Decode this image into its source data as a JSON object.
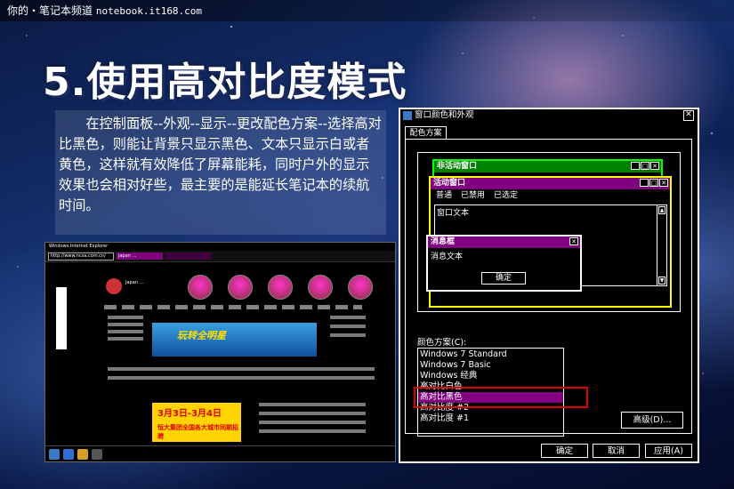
{
  "header": {
    "site_name": "你的・笔记本频道",
    "site_url": "notebook.it168.com"
  },
  "title": "5.使用高对比度模式",
  "description": "在控制面板--外观--显示--更改配色方案--选择高对比黑色，则能让背景只显示黑色、文本只显示白或者黄色，这样就有效降低了屏幕能耗，同时户外的显示效果也会相对好些，最主要的是能延长笔记本的续航时间。",
  "browser": {
    "window_title": "Windows Internet Explorer",
    "url": "http://www.ncsa.com.cn/",
    "tab_label": "Japan ...",
    "banner_text": "玩转全明星",
    "ad_line1": "3月3日-3月4日",
    "ad_line2": "恒大集团全国各大城市同期招聘"
  },
  "dialog": {
    "title": "窗口颜色和外观",
    "close_symbol": "✕",
    "tab_label": "配色方案",
    "preview": {
      "inactive_title": "非活动窗口",
      "active_title": "活动窗口",
      "menu_items": [
        "普通",
        "已禁用",
        "已选定"
      ],
      "window_text": "窗口文本",
      "message_title": "消息框",
      "message_text": "消息文本",
      "ok_label": "确定"
    },
    "scheme_label": "颜色方案(C):",
    "schemes": [
      "Windows 7 Standard",
      "Windows 7 Basic",
      "Windows 经典",
      "高对比白色",
      "高对比黑色",
      "高对比度 #2",
      "高对比度 #1"
    ],
    "selected_scheme": "高对比黑色",
    "advanced_label": "高级(D)...",
    "ok_label": "确定",
    "cancel_label": "取消",
    "apply_label": "应用(A)"
  },
  "colors": {
    "active_title": "#800080",
    "inactive_title": "#008000",
    "highlight_box": "#e00000"
  }
}
